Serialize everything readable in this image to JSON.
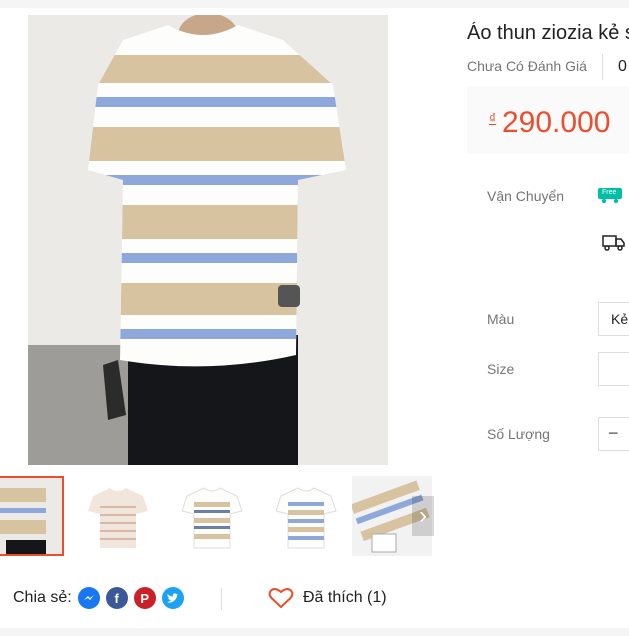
{
  "product": {
    "title": "Áo thun ziozia kẻ s",
    "rating_text": "Chưa Có Đánh Giá",
    "sold_count": "0",
    "currency": "₫",
    "price": "290.000"
  },
  "options": {
    "shipping_label": "Vận Chuyển",
    "free_badge": "Free",
    "color_label": "Màu",
    "color_value": "Kẻ",
    "size_label": "Size",
    "quantity_label": "Số Lượng",
    "decrement": "−"
  },
  "share": {
    "label": "Chia sẻ:",
    "icons": [
      "messenger-icon",
      "facebook-icon",
      "pinterest-icon",
      "twitter-icon"
    ]
  },
  "like": {
    "text": "Đã thích (1)"
  },
  "gallery": {
    "next_arrow": "›"
  },
  "colors": {
    "accent": "#ee4d2d",
    "stripe_beige": "#d8c3a0",
    "stripe_blue": "#8ea8dc",
    "messenger": "#1877f2",
    "facebook": "#3b5998",
    "pinterest": "#cb2027",
    "twitter": "#1da1f2"
  }
}
